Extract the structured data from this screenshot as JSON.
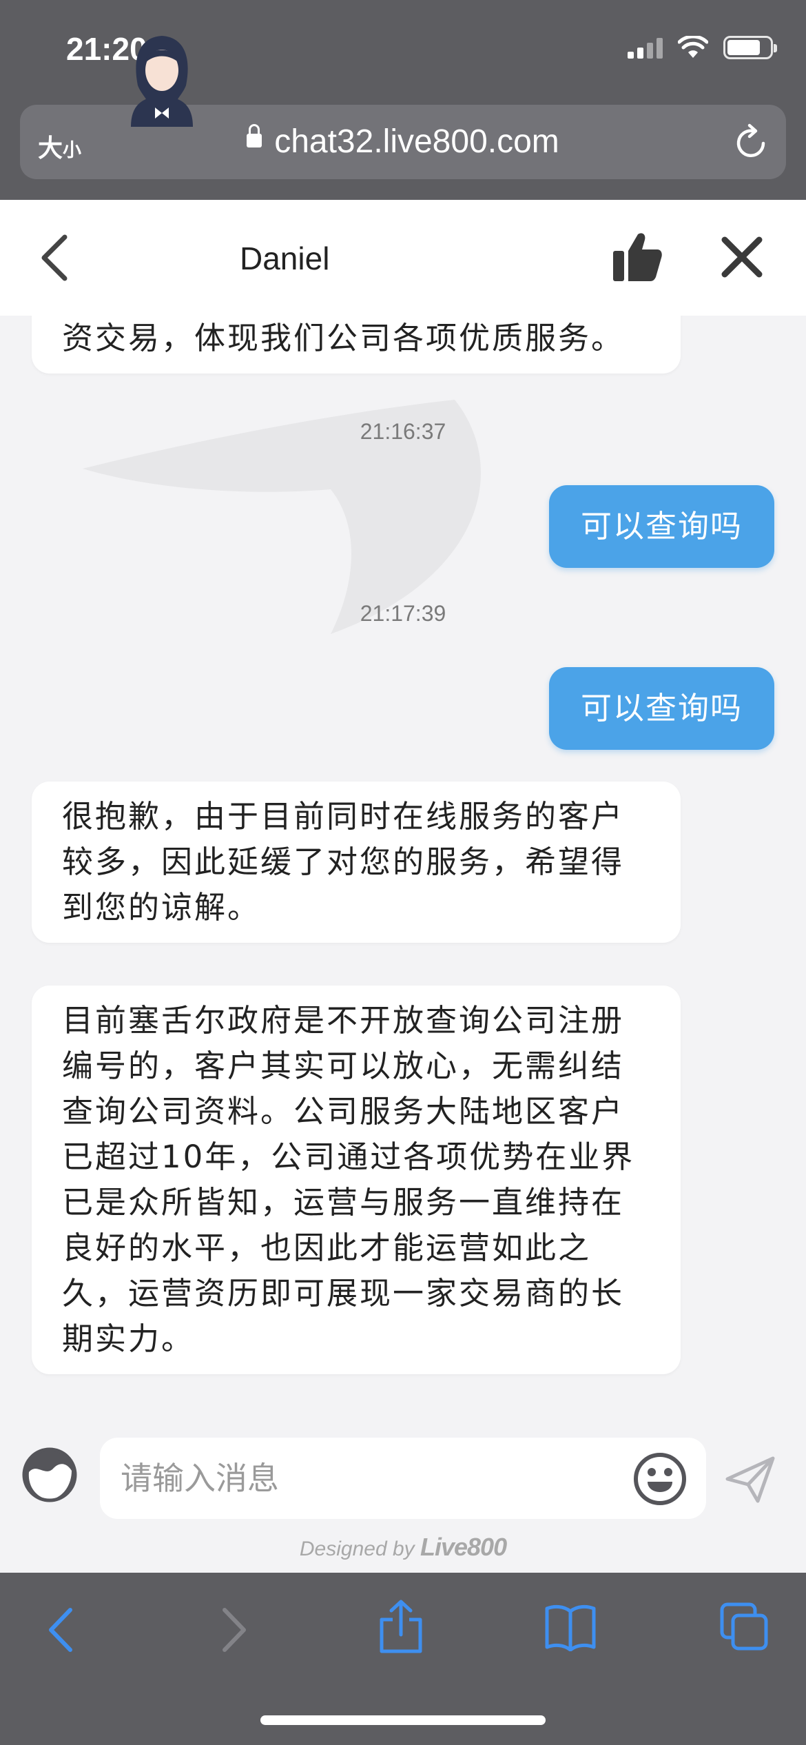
{
  "status_bar": {
    "time": "21:20"
  },
  "browser": {
    "text_size_label_big": "大",
    "text_size_label_small": "小",
    "url": "chat32.live800.com"
  },
  "chat_header": {
    "agent_name": "Daniel"
  },
  "messages": [
    {
      "type": "agent",
      "text": "资交易，体现我们公司各项优质服务。"
    },
    {
      "type": "timestamp",
      "text": "21:16:37"
    },
    {
      "type": "user",
      "text": "可以查询吗"
    },
    {
      "type": "timestamp",
      "text": "21:17:39"
    },
    {
      "type": "user",
      "text": "可以查询吗"
    },
    {
      "type": "agent",
      "text": "很抱歉，由于目前同时在线服务的客户较多，因此延缓了对您的服务，希望得到您的谅解。"
    },
    {
      "type": "agent",
      "text": "目前塞舌尔政府是不开放查询公司注册编号的，客户其实可以放心，无需纠结查询公司资料。公司服务大陆地区客户已超过10年，公司通过各项优势在业界已是众所皆知，运营与服务一直维持在良好的水平，也因此才能运营如此之久，运营资历即可展现一家交易商的长期实力。"
    }
  ],
  "input": {
    "placeholder": "请输入消息",
    "value": ""
  },
  "footer": {
    "designed_by": "Designed by",
    "brand": "Live800"
  },
  "icons": {
    "back": "chevron-left-icon",
    "thumb": "thumbs-up-icon",
    "close": "close-icon",
    "theme": "theme-icon",
    "emoji": "emoji-icon",
    "send": "send-icon",
    "share": "share-icon",
    "bookmarks": "book-icon",
    "tabs": "tabs-icon"
  },
  "colors": {
    "user_bubble": "#4ba3e8",
    "browser_chrome": "#5d5d61",
    "toolbar_accent": "#3e8ff0"
  }
}
